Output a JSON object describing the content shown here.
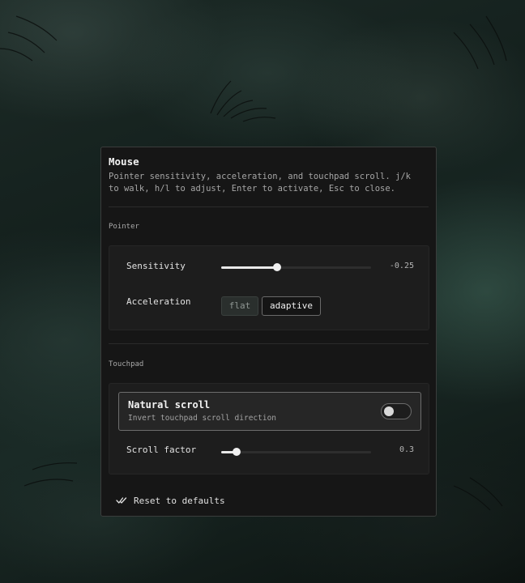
{
  "dialog": {
    "title": "Mouse",
    "subtitle": "Pointer sensitivity, acceleration, and touchpad scroll. j/k to walk, h/l to adjust, Enter to activate, Esc to close."
  },
  "pointer": {
    "section_label": "Pointer",
    "sensitivity": {
      "label": "Sensitivity",
      "value_text": "-0.25",
      "fraction": 0.375
    },
    "acceleration": {
      "label": "Acceleration",
      "options": [
        "flat",
        "adaptive"
      ],
      "selected": "adaptive"
    }
  },
  "touchpad": {
    "section_label": "Touchpad",
    "natural_scroll": {
      "title": "Natural scroll",
      "description": "Invert touchpad scroll direction",
      "enabled": false
    },
    "scroll_factor": {
      "label": "Scroll factor",
      "value_text": "0.3",
      "fraction": 0.1
    }
  },
  "footer": {
    "reset_label": "Reset to defaults"
  },
  "icons": {
    "reset": "double-check-icon"
  },
  "colors": {
    "accent": "#e8e8e8",
    "panel": "#161616",
    "group": "#1d1d1d"
  }
}
